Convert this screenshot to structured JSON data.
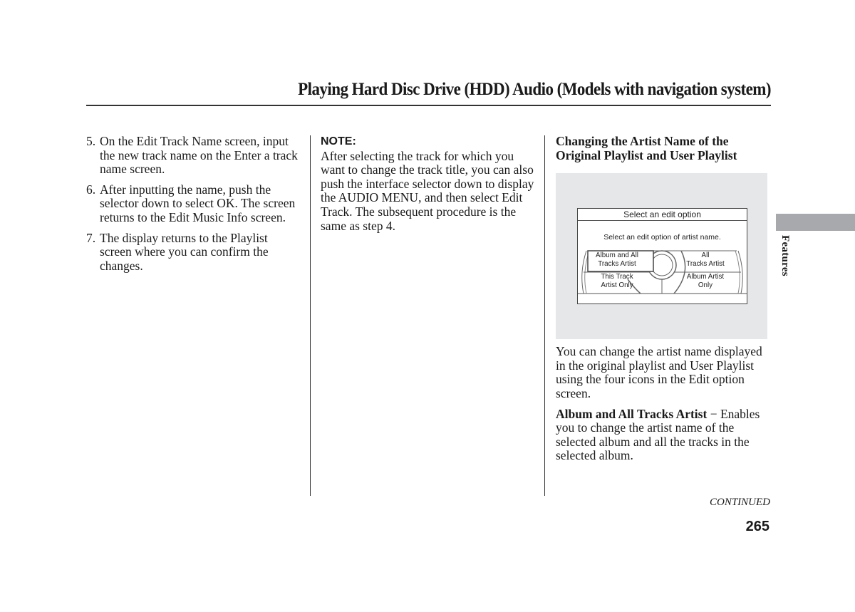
{
  "header": {
    "title": "Playing Hard Disc Drive (HDD) Audio (Models with navigation system)"
  },
  "column1": {
    "steps": [
      {
        "num": "5.",
        "text": "On the Edit Track Name screen, input the new track name on the Enter a track name screen."
      },
      {
        "num": "6.",
        "text": "After inputting the name, push the selector down to select OK. The screen returns to the Edit Music Info screen."
      },
      {
        "num": "7.",
        "text": "The display returns to the Playlist screen where you can confirm the changes."
      }
    ]
  },
  "column2": {
    "note_heading": "NOTE:",
    "note_text": "After selecting the track for which you want to change the track title, you can also push the interface selector down to display the AUDIO MENU, and then select Edit Track. The subsequent procedure is the same as step 4."
  },
  "column3": {
    "section_heading": "Changing the Artist Name of the Original Playlist and User Playlist",
    "figure": {
      "screen_title": "Select an edit option",
      "screen_subtitle": "Select an edit option of artist name.",
      "options": {
        "top_left": [
          "Album and All",
          "Tracks Artist"
        ],
        "top_right": [
          "All",
          "Tracks Artist"
        ],
        "bottom_left": [
          "This Track",
          "Artist Only"
        ],
        "bottom_right": [
          "Album Artist",
          "Only"
        ]
      },
      "selected_option": "Album and All Tracks Artist"
    },
    "paragraph": "You can change the artist name displayed in the original playlist and User Playlist using the four icons in the Edit option screen.",
    "definition_term": "Album and All Tracks Artist",
    "definition_dash": "−",
    "definition_text": "Enables you to change the artist name of the selected album and all the tracks in the selected album."
  },
  "side_tab": {
    "label": "Features",
    "color": "#a7a9ac"
  },
  "footer": {
    "continued": "CONTINUED",
    "page_number": "265"
  }
}
